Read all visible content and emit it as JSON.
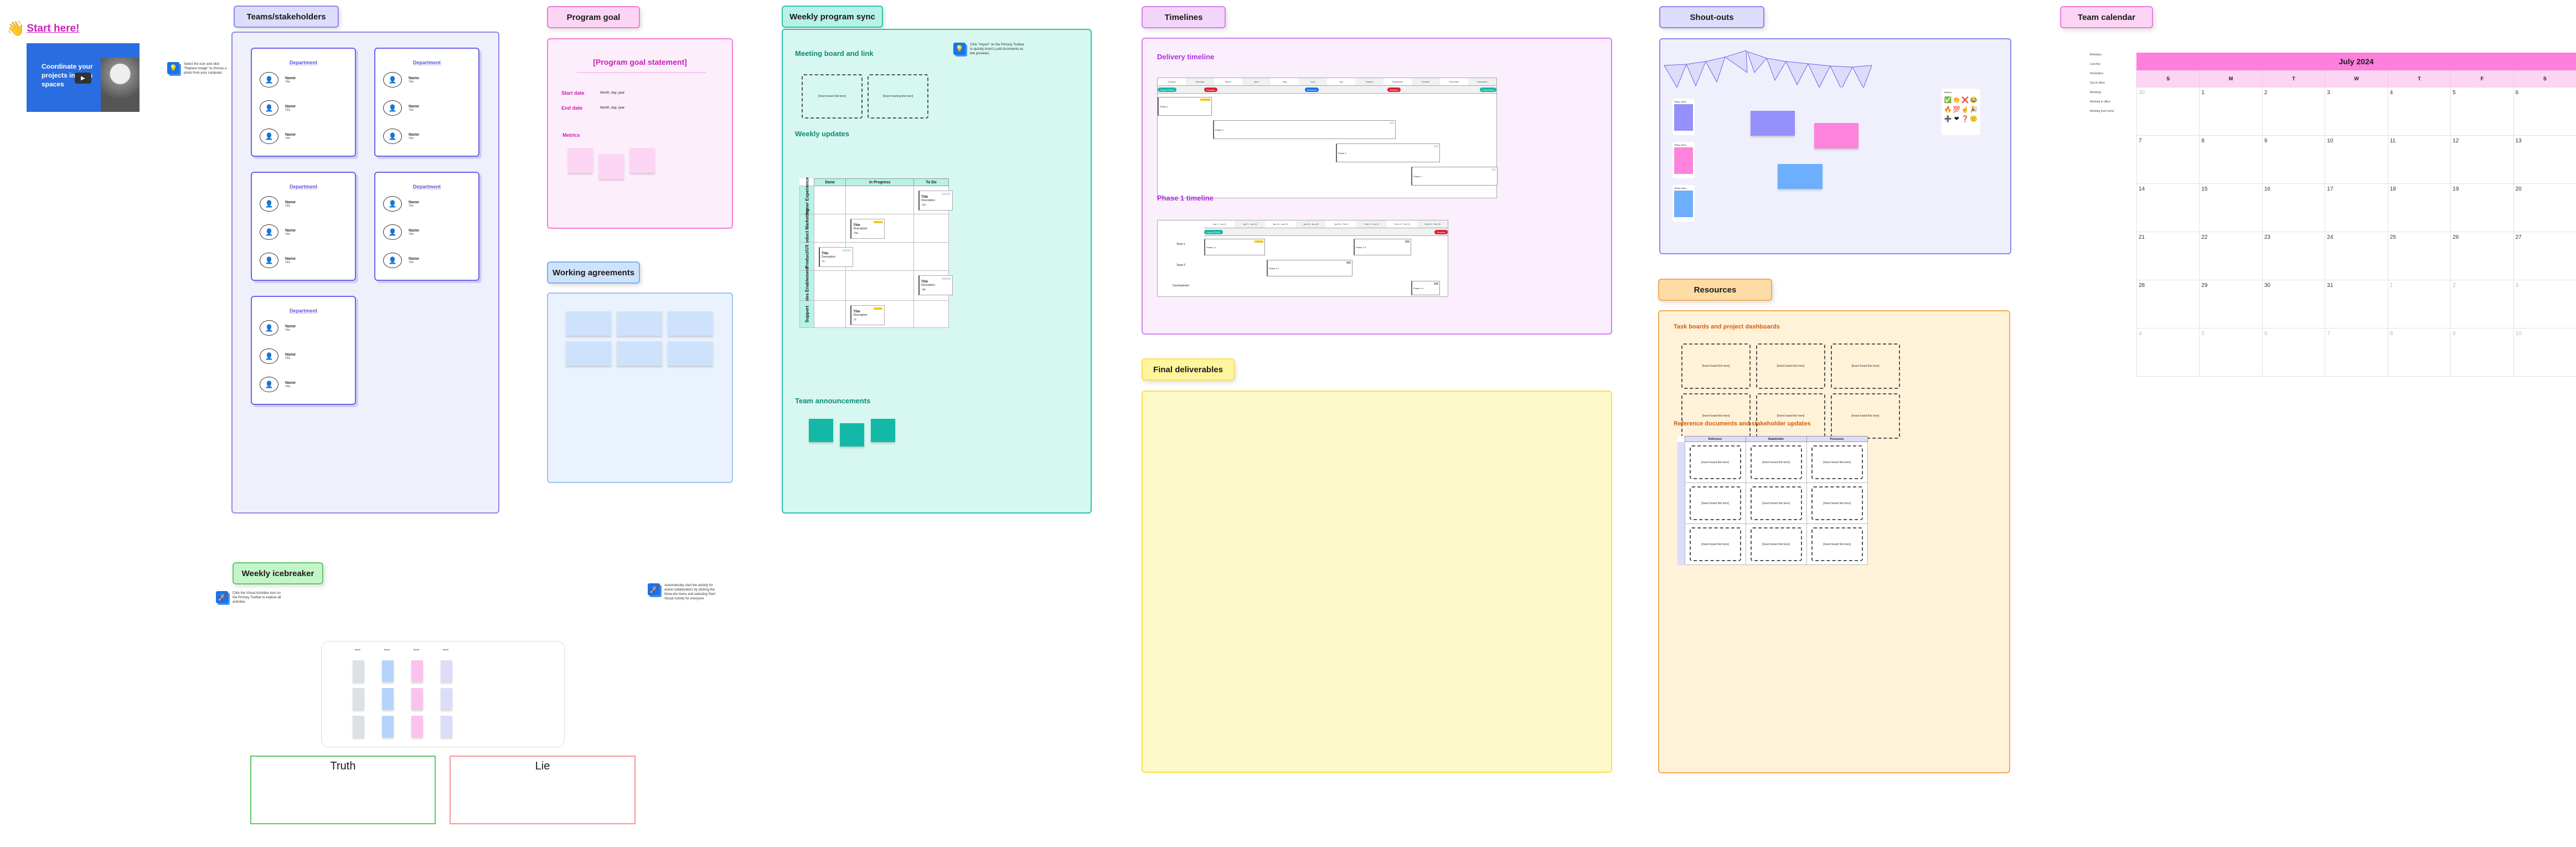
{
  "start": {
    "title": "Start here!",
    "video_title": "Coordinate your projects in team spaces",
    "hint": "Select the icon and click \"Replace Image\" to choose a photo from your computer."
  },
  "teams": {
    "tab": "Teams/stakeholders",
    "departments": [
      {
        "name": "Department",
        "people": [
          {
            "name": "Name",
            "title": "Title"
          },
          {
            "name": "Name",
            "title": "Title"
          },
          {
            "name": "Name",
            "title": "Title"
          }
        ]
      },
      {
        "name": "Department",
        "people": [
          {
            "name": "Name",
            "title": "Title"
          },
          {
            "name": "Name",
            "title": "Title"
          },
          {
            "name": "Name",
            "title": "Title"
          }
        ]
      },
      {
        "name": "Department",
        "people": [
          {
            "name": "Name",
            "title": "Title"
          },
          {
            "name": "Name",
            "title": "Title"
          },
          {
            "name": "Name",
            "title": "Title"
          }
        ]
      },
      {
        "name": "Department",
        "people": [
          {
            "name": "Name",
            "title": "Title"
          },
          {
            "name": "Name",
            "title": "Title"
          },
          {
            "name": "Name",
            "title": "Title"
          }
        ]
      },
      {
        "name": "Department",
        "people": [
          {
            "name": "Name",
            "title": "Title"
          },
          {
            "name": "Name",
            "title": "Title"
          },
          {
            "name": "Name",
            "title": "Title"
          }
        ]
      }
    ]
  },
  "program_goal": {
    "tab": "Program goal",
    "statement": "[Program goal statement]",
    "start_label": "Start date",
    "start_value": "Month, day, year",
    "end_label": "End date",
    "end_value": "Month, day, year",
    "metrics_label": "Metrics"
  },
  "working_agreements": {
    "tab": "Working agreements"
  },
  "weekly_sync": {
    "tab": "Weekly program sync",
    "meeting_heading": "Meeting board and link",
    "board_link": "[Insert board link here]",
    "meeting_link": "[Insert meeting link here]",
    "hint": "Click \"Import\" on the Primary Toolbar to quickly insert Lucid documents as link previews.",
    "updates_heading": "Weekly updates",
    "columns": [
      "Done",
      "In Progress",
      "To Do"
    ],
    "rows": [
      "Customer Experience",
      "Product Marketing",
      "Product/UX",
      "Sales Enablement",
      "Support"
    ],
    "cards": [
      {
        "title": "Title",
        "desc": "Description",
        "tag": "CE",
        "status": "To Do"
      },
      {
        "title": "Title",
        "desc": "Description",
        "tag": "PM",
        "status": "In Progress"
      },
      {
        "title": "Title",
        "desc": "Description",
        "tag": "P",
        "status": "Done"
      },
      {
        "title": "Title",
        "desc": "Description",
        "tag": "SE",
        "status": "To Do"
      },
      {
        "title": "Title",
        "desc": "Description",
        "tag": "S",
        "status": "In Progress"
      }
    ],
    "announcements_heading": "Team announcements"
  },
  "timelines": {
    "tab": "Timelines",
    "delivery_heading": "Delivery timeline",
    "months": [
      "January",
      "February",
      "March",
      "April",
      "May",
      "June",
      "July",
      "August",
      "September",
      "October",
      "November",
      "December"
    ],
    "milestones": [
      {
        "label": "Project START",
        "color": "#14b8a6"
      },
      {
        "label": "Deadline",
        "color": "#e11d2e"
      },
      {
        "label": "Milestone",
        "color": "#1a73e8"
      },
      {
        "label": "Deadline",
        "color": "#e11d2e"
      },
      {
        "label": "Project END",
        "color": "#14b8a6"
      }
    ],
    "phases": [
      {
        "label": "Phase 1",
        "status": "In Progress"
      },
      {
        "label": "Phase 2",
        "status": "To Do"
      },
      {
        "label": "Phase 3",
        "status": "To Do"
      },
      {
        "label": "Phase 4",
        "status": "To Do"
      }
    ],
    "phase1_heading": "Phase 1 timeline",
    "weeks": [
      "Jan 2 - Jan 8",
      "Jan 9 - Jan 15",
      "Jan 16 - Jan 22",
      "Jan 23 - Jan 29",
      "Jan 30 - Feb 5",
      "Feb 6 - Feb 12",
      "Feb 13 - Feb 19",
      "Feb 20 - Feb 26"
    ],
    "phase1_milestones": [
      {
        "label": "Project START",
        "color": "#14b8a6"
      },
      {
        "label": "Deadline",
        "color": "#e11d2e"
      }
    ],
    "lanes": [
      "Team 1",
      "Team 2",
      "Development"
    ],
    "subphases": [
      {
        "label": "Phase 1.1",
        "tag": "T1",
        "status": "In Progress"
      },
      {
        "label": "Phase 1.3",
        "tag": "T1",
        "status": "To Do"
      },
      {
        "label": "Phase 1.2",
        "tag": "T2",
        "status": "To Do"
      },
      {
        "label": "Phase 1.4",
        "tag": "",
        "status": "To Do"
      }
    ]
  },
  "final_deliverables": {
    "tab": "Final deliverables"
  },
  "shoutouts": {
    "tab": "Shout-outs",
    "sticky_label": "Sticky notes",
    "stickers_label": "Stickers",
    "stickers": [
      "✅",
      "👏",
      "❌",
      "😂",
      "🔥",
      "💯",
      "☝",
      "🎉",
      "➕",
      "❤",
      "❓",
      "🙂"
    ]
  },
  "resources": {
    "tab": "Resources",
    "task_heading": "Task boards and project dashboards",
    "board_link": "[Insert board link here]",
    "ref_heading": "Reference documents and stakeholder updates",
    "columns": [
      "Reference",
      "Stakeholder",
      "Processes"
    ]
  },
  "icebreaker": {
    "tab": "Weekly icebreaker",
    "hint_left": "Click the Visual Activities icon on the Primary Toolbar to explore all activities",
    "hint_right": "Automatically start the activity for active collaborators by clicking the three-dot menu and selecting Start Visual Activity for everyone",
    "names": [
      "Name",
      "Name",
      "Name",
      "Name"
    ],
    "truth": "Truth",
    "lie": "Lie"
  },
  "calendar": {
    "tab": "Team calendar",
    "month": "July 2024",
    "weekdays": [
      "S",
      "M",
      "T",
      "W",
      "T",
      "F",
      "S"
    ],
    "legend": [
      "Birthdays",
      "Lunches",
      "Reminders",
      "Out of office",
      "Meetings",
      "Working in office",
      "Working from home"
    ],
    "days": [
      {
        "d": "30",
        "o": true
      },
      {
        "d": "1"
      },
      {
        "d": "2"
      },
      {
        "d": "3"
      },
      {
        "d": "4"
      },
      {
        "d": "5"
      },
      {
        "d": "6"
      },
      {
        "d": "7"
      },
      {
        "d": "8"
      },
      {
        "d": "9"
      },
      {
        "d": "10"
      },
      {
        "d": "11"
      },
      {
        "d": "12"
      },
      {
        "d": "13"
      },
      {
        "d": "14"
      },
      {
        "d": "15"
      },
      {
        "d": "16"
      },
      {
        "d": "17"
      },
      {
        "d": "18"
      },
      {
        "d": "19"
      },
      {
        "d": "20"
      },
      {
        "d": "21"
      },
      {
        "d": "22"
      },
      {
        "d": "23"
      },
      {
        "d": "24"
      },
      {
        "d": "25"
      },
      {
        "d": "26"
      },
      {
        "d": "27"
      },
      {
        "d": "28"
      },
      {
        "d": "29"
      },
      {
        "d": "30"
      },
      {
        "d": "31"
      },
      {
        "d": "1",
        "o": true
      },
      {
        "d": "2",
        "o": true
      },
      {
        "d": "3",
        "o": true
      },
      {
        "d": "4",
        "o": true
      },
      {
        "d": "5",
        "o": true
      },
      {
        "d": "6",
        "o": true
      },
      {
        "d": "7",
        "o": true
      },
      {
        "d": "8",
        "o": true
      },
      {
        "d": "9",
        "o": true
      },
      {
        "d": "10",
        "o": true
      }
    ]
  }
}
